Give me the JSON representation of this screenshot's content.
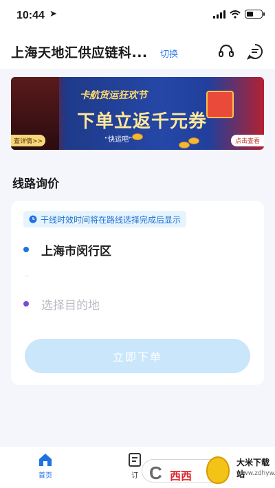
{
  "status_bar": {
    "time": "10:44",
    "location_icon": "location-arrow-icon",
    "signal_icon": "cellular-signal-icon",
    "wifi_icon": "wifi-icon",
    "battery_icon": "battery-icon",
    "battery_level": 0.45
  },
  "header": {
    "company_name": "上海天地汇供应链科...",
    "switch_label": "切换",
    "icons": [
      "headset-icon",
      "chat-bubble-icon"
    ]
  },
  "banner": {
    "subtitle": "卡航货运狂欢节",
    "title": "下单立返千元券",
    "brand": "“快运吧”",
    "left_tag": "查详情>>",
    "cta": "点击查看"
  },
  "route_inquiry": {
    "section_title": "线路询价",
    "notice": "干线时效时间将在路线选择完成后显示",
    "origin": "上海市闵行区",
    "destination_placeholder": "选择目的地",
    "submit_label": "立即下单"
  },
  "tabbar": {
    "tabs": [
      {
        "label": "首页",
        "icon": "home-icon",
        "active": true
      },
      {
        "label": "订",
        "icon": "orders-icon",
        "active": false
      }
    ]
  },
  "watermark": {
    "brand": "大米下载站",
    "url": "www.zdhyw.com",
    "text_red": "西西"
  },
  "colors": {
    "accent": "#1f73e0",
    "button_disabled": "#c9e6fb",
    "notice_bg": "#e6f4ff",
    "destination_dot": "#7a4cd6"
  }
}
